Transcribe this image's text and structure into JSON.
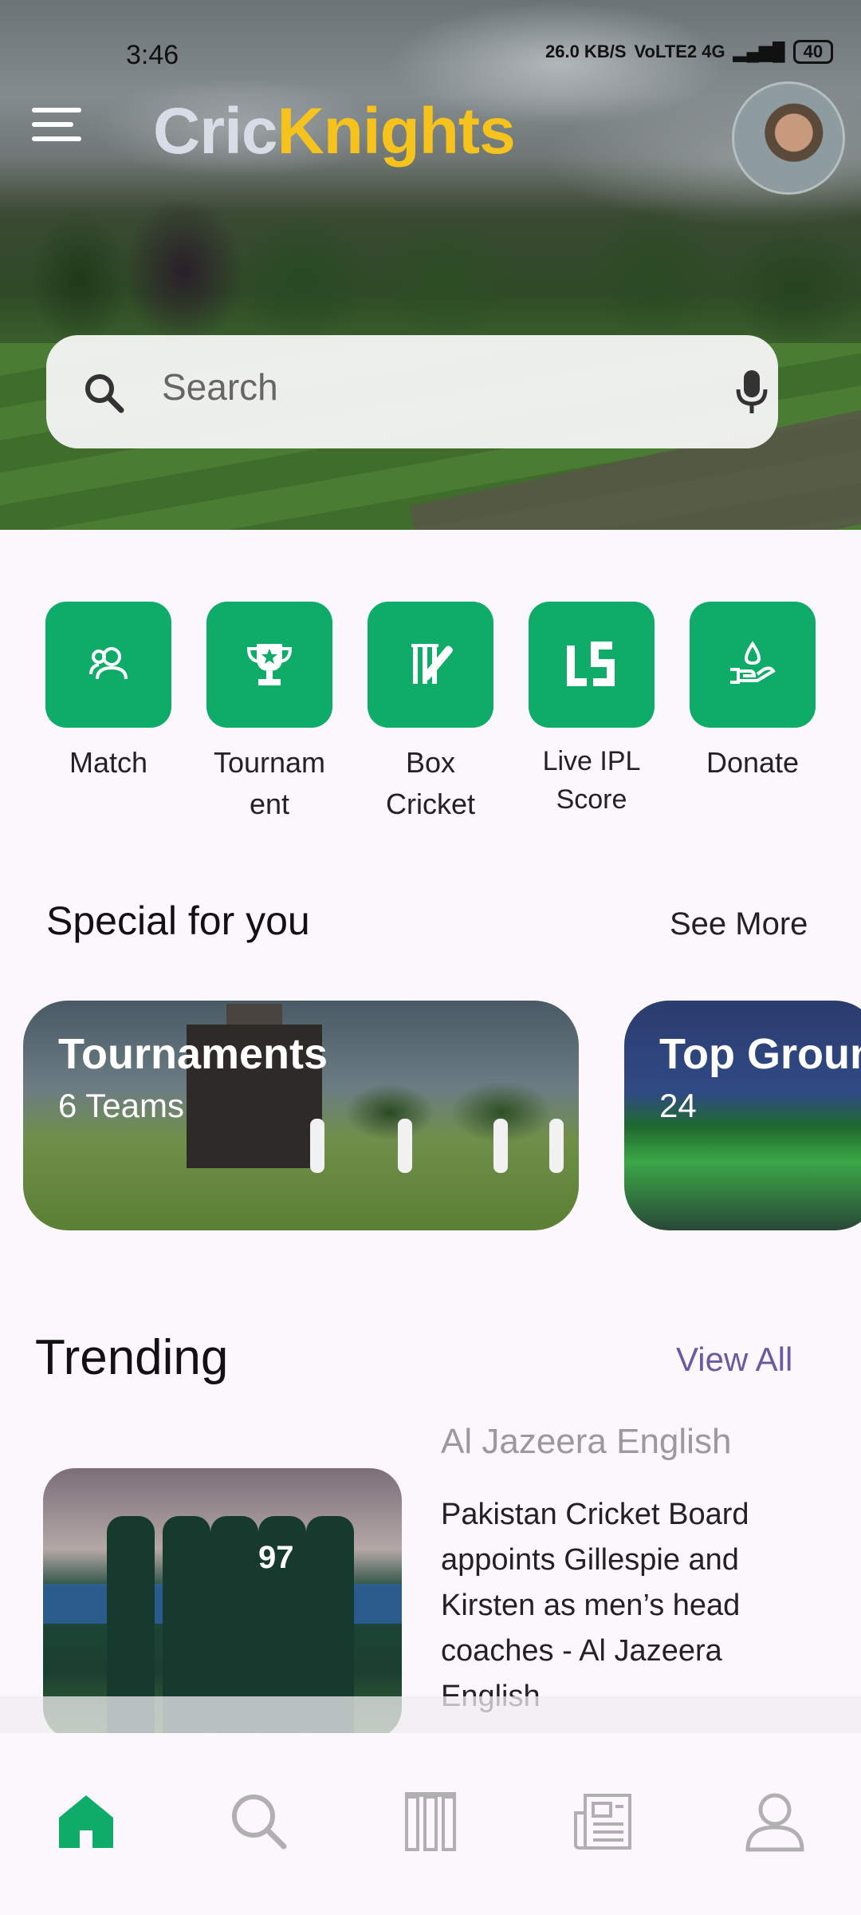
{
  "status_bar": {
    "time": "3:46",
    "net_speed": "26.0 KB/S",
    "network": "VoLTE2 4G",
    "battery": "40"
  },
  "header": {
    "logo_part1": "Cric",
    "logo_part2": "Knights"
  },
  "search": {
    "placeholder": "Search"
  },
  "quick_actions": [
    {
      "label": "Match",
      "icon": "people-icon"
    },
    {
      "label": "Tournam ent",
      "icon": "trophy-icon"
    },
    {
      "label": "Box Cricket",
      "icon": "cricket-bat-icon"
    },
    {
      "label": "Live IPL Score",
      "icon": "live-score-icon"
    },
    {
      "label": "Donate",
      "icon": "donate-hand-icon"
    }
  ],
  "special": {
    "title": "Special for you",
    "see_more": "See More",
    "cards": [
      {
        "title": "Tournaments",
        "subtitle": "6 Teams"
      },
      {
        "title": "Top Grounds",
        "subtitle": "24"
      }
    ]
  },
  "trending": {
    "title": "Trending",
    "view_all": "View All",
    "article": {
      "source": "Al Jazeera English",
      "headline": "Pakistan Cricket Board appoints Gillespie and Kirsten as men’s head coaches - Al Jazeera English",
      "jersey_number": "97"
    }
  },
  "bottom_nav": [
    "home-icon",
    "search-icon",
    "stumps-icon",
    "news-icon",
    "profile-icon"
  ],
  "colors": {
    "accent": "#0eab69",
    "logo_yellow": "#f6c21c",
    "link_purple": "#6a5aa4"
  }
}
